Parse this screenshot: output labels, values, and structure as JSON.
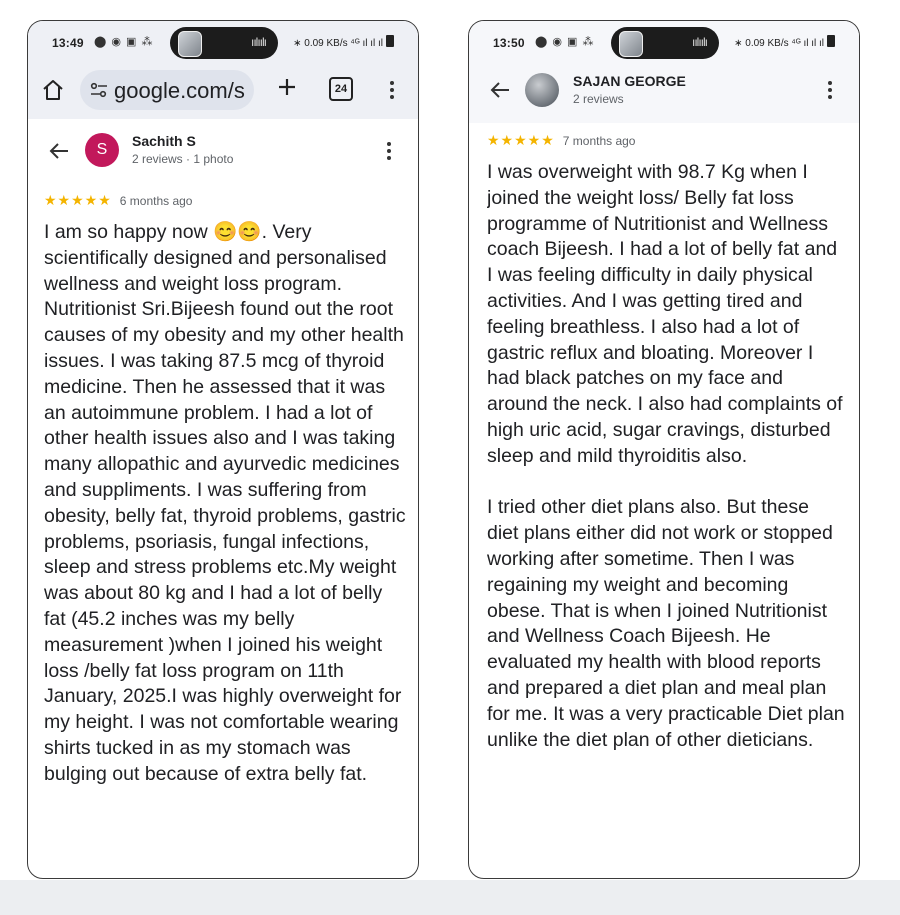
{
  "left_phone": {
    "status": {
      "time": "13:49",
      "left_icons": "⬤ ◉ ▣ ⁂",
      "right_icons": "∗ 0.09 KB/s ⁴ᴳ ıl ıl ıl"
    },
    "browser": {
      "url": "google.com/s",
      "tab_count": "24"
    },
    "review": {
      "avatar_letter": "S",
      "avatar_color": "#c2185b",
      "name": "Sachith S",
      "meta": "2 reviews · 1 photo",
      "stars": "★★★★★",
      "time": "6 months ago",
      "text": "I am so happy now 😊😊. Very scientifically designed and personalised wellness and weight loss program. Nutritionist Sri.Bijeesh found out the root causes of my obesity and my other health issues. I was taking 87.5 mcg of thyroid medicine. Then he assessed that it was an autoimmune problem. I had a lot of other health issues also and I was taking many allopathic and ayurvedic medicines and suppliments. I was suffering from obesity, belly fat, thyroid problems, gastric problems, psoriasis, fungal infections, sleep and stress problems etc.My weight was about 80 kg and I had a lot of belly fat (45.2 inches was my belly measurement )when I joined his weight loss /belly fat loss program on 11th January, 2025.I was highly overweight for my height. I was not comfortable wearing shirts tucked in as my stomach was bulging out because of extra belly fat."
    }
  },
  "right_phone": {
    "status": {
      "time": "13:50",
      "left_icons": "⬤ ◉ ▣ ⁂",
      "right_icons": "∗ 0.09 KB/s ⁴ᴳ ıl ıl ıl"
    },
    "review": {
      "name": "SAJAN GEORGE",
      "meta": "2 reviews",
      "stars": "★★★★★",
      "time": "7 months ago",
      "text": "I was overweight with 98.7 Kg when I joined the weight loss/ Belly fat loss programme of Nutritionist and Wellness coach Bijeesh. I had a lot of belly fat and I was feeling difficulty in daily physical activities. And I was getting tired and feeling breathless. I also had a lot of gastric reflux and bloating. Moreover I had black patches on my face and around the neck. I also had complaints of high uric acid, sugar cravings, disturbed sleep and mild thyroiditis also.\n\nI tried other diet plans also. But these diet plans either did not work or stopped working after sometime. Then I was regaining my weight and becoming obese. That is when I joined Nutritionist and Wellness Coach Bijeesh. He evaluated my health with blood reports and prepared a diet plan and meal plan for me. It was a very practicable Diet plan unlike the diet plan of other dieticians."
    }
  }
}
